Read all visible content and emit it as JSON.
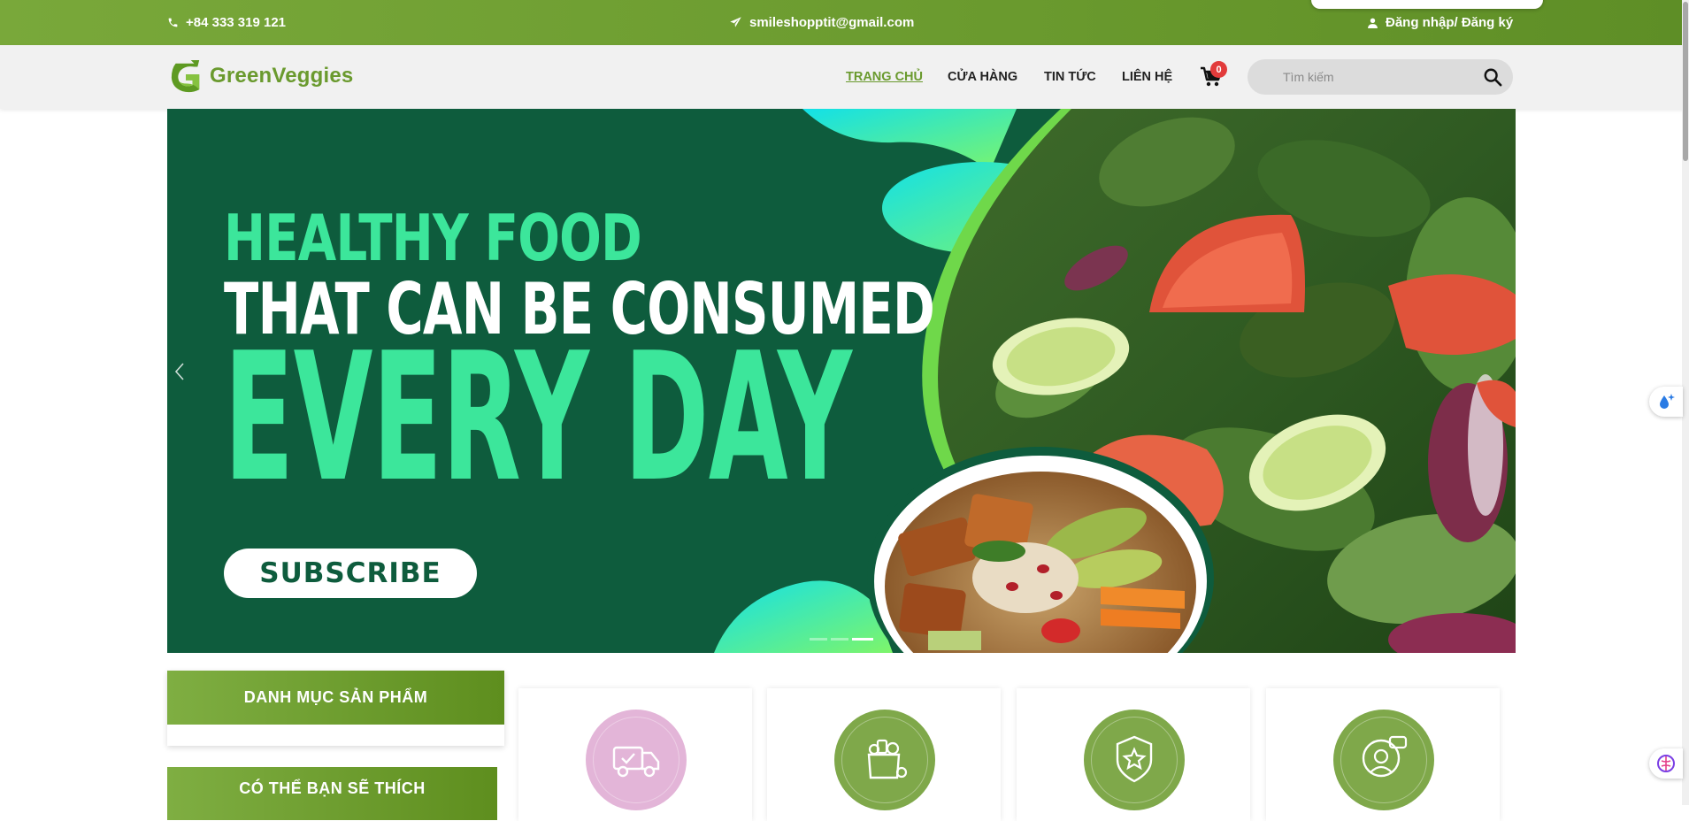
{
  "topbar": {
    "phone": "+84 333 319 121",
    "email": "smileshopptit@gmail.com",
    "login": "Đăng nhập/ Đăng ký"
  },
  "header": {
    "logo_text": "GreenVeggies",
    "nav": [
      {
        "label": "TRANG CHỦ",
        "active": true
      },
      {
        "label": "CỬA HÀNG",
        "active": false
      },
      {
        "label": "TIN TỨC",
        "active": false
      },
      {
        "label": "LIÊN HỆ",
        "active": false
      }
    ],
    "cart_count": "0",
    "search_placeholder": "Tìm kiếm"
  },
  "banner": {
    "line1": "HEALTHY FOOD",
    "line2": "THAT CAN BE CONSUMED",
    "line3": "EVERY DAY",
    "button": "SUBSCRIBE",
    "slide_count": 3,
    "active_slide": 3
  },
  "sidebar": {
    "categories_title": "DANH MỤC SẢN PHẨM",
    "you_may_like_title": "CÓ THỂ BẠN SẼ THÍCH"
  },
  "features": [
    {
      "icon": "delivery-truck-icon",
      "color": "#e3b5d8"
    },
    {
      "icon": "grocery-bag-icon",
      "color": "#7fa84a"
    },
    {
      "icon": "quality-badge-icon",
      "color": "#7fa84a"
    },
    {
      "icon": "customer-support-icon",
      "color": "#7fa84a"
    }
  ],
  "colors": {
    "brand_green": "#6a9a2e",
    "banner_green": "#0e5c3d",
    "accent_mint": "#3ce69b",
    "badge_red": "#e23b3b"
  }
}
